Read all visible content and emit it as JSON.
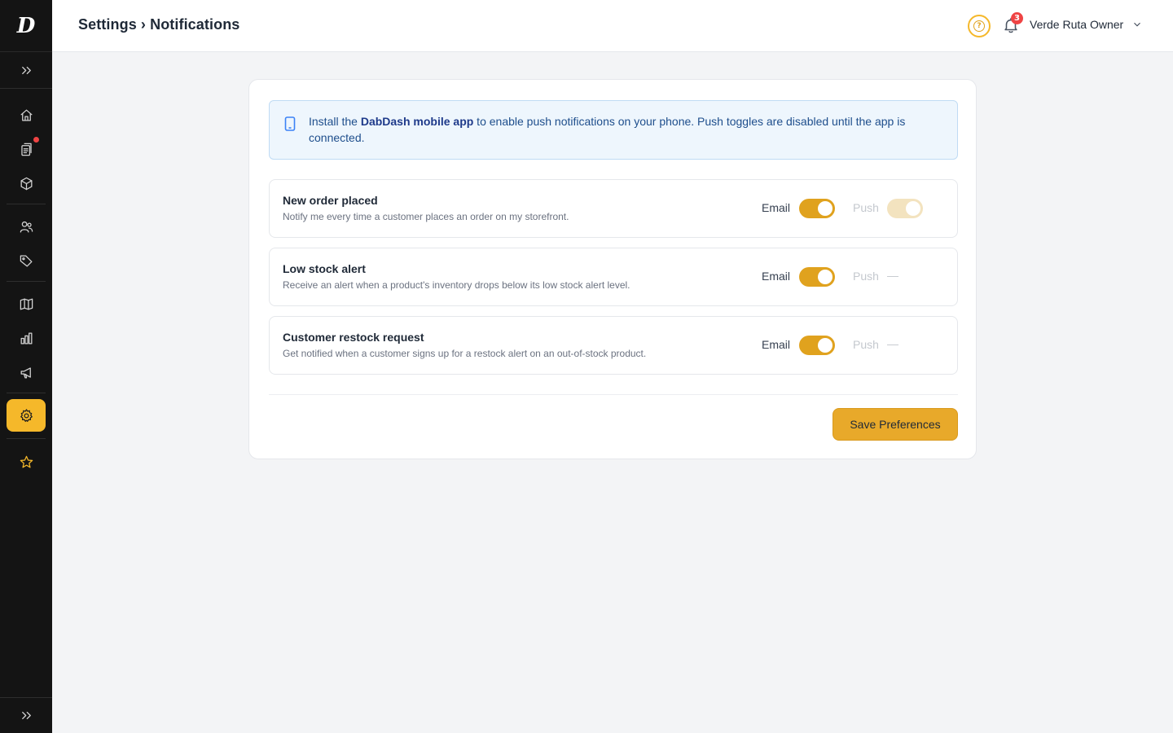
{
  "app": {
    "logo_letter": "D"
  },
  "sidebar": {
    "items": [
      {
        "icon": "home-icon"
      },
      {
        "icon": "orders-icon",
        "has_dot": true
      },
      {
        "icon": "box-icon"
      },
      {
        "icon": "customers-icon"
      },
      {
        "icon": "tag-icon"
      },
      {
        "icon": "map-icon"
      },
      {
        "icon": "chart-icon"
      },
      {
        "icon": "megaphone-icon"
      },
      {
        "icon": "gear-icon",
        "active": true
      },
      {
        "icon": "star-icon"
      }
    ]
  },
  "header": {
    "breadcrumb": "Settings › Notifications",
    "help_glyph": "?",
    "notification_count": "3",
    "user_name": "Verde Ruta Owner"
  },
  "banner": {
    "prefix": "Install the ",
    "app_name": "DabDash mobile app",
    "suffix": " to enable push notifications on your phone. Push toggles are disabled until the app is connected."
  },
  "labels": {
    "email": "Email",
    "push": "Push",
    "unavailable": "—"
  },
  "notifications": [
    {
      "title": "New order placed",
      "description": "Notify me every time a customer places an order on my storefront.",
      "email": true,
      "push": true,
      "push_available": true
    },
    {
      "title": "Low stock alert",
      "description": "Receive an alert when a product's inventory drops below its low stock alert level.",
      "email": true,
      "push": null,
      "push_available": false
    },
    {
      "title": "Customer restock request",
      "description": "Get notified when a customer signs up for a restock alert on an out-of-stock product.",
      "email": true,
      "push": null,
      "push_available": false
    }
  ],
  "actions": {
    "save_label": "Save Preferences"
  },
  "colors": {
    "accent": "#e0a21e",
    "sidebar_bg": "#141414",
    "info_bg": "#eef6fd"
  }
}
